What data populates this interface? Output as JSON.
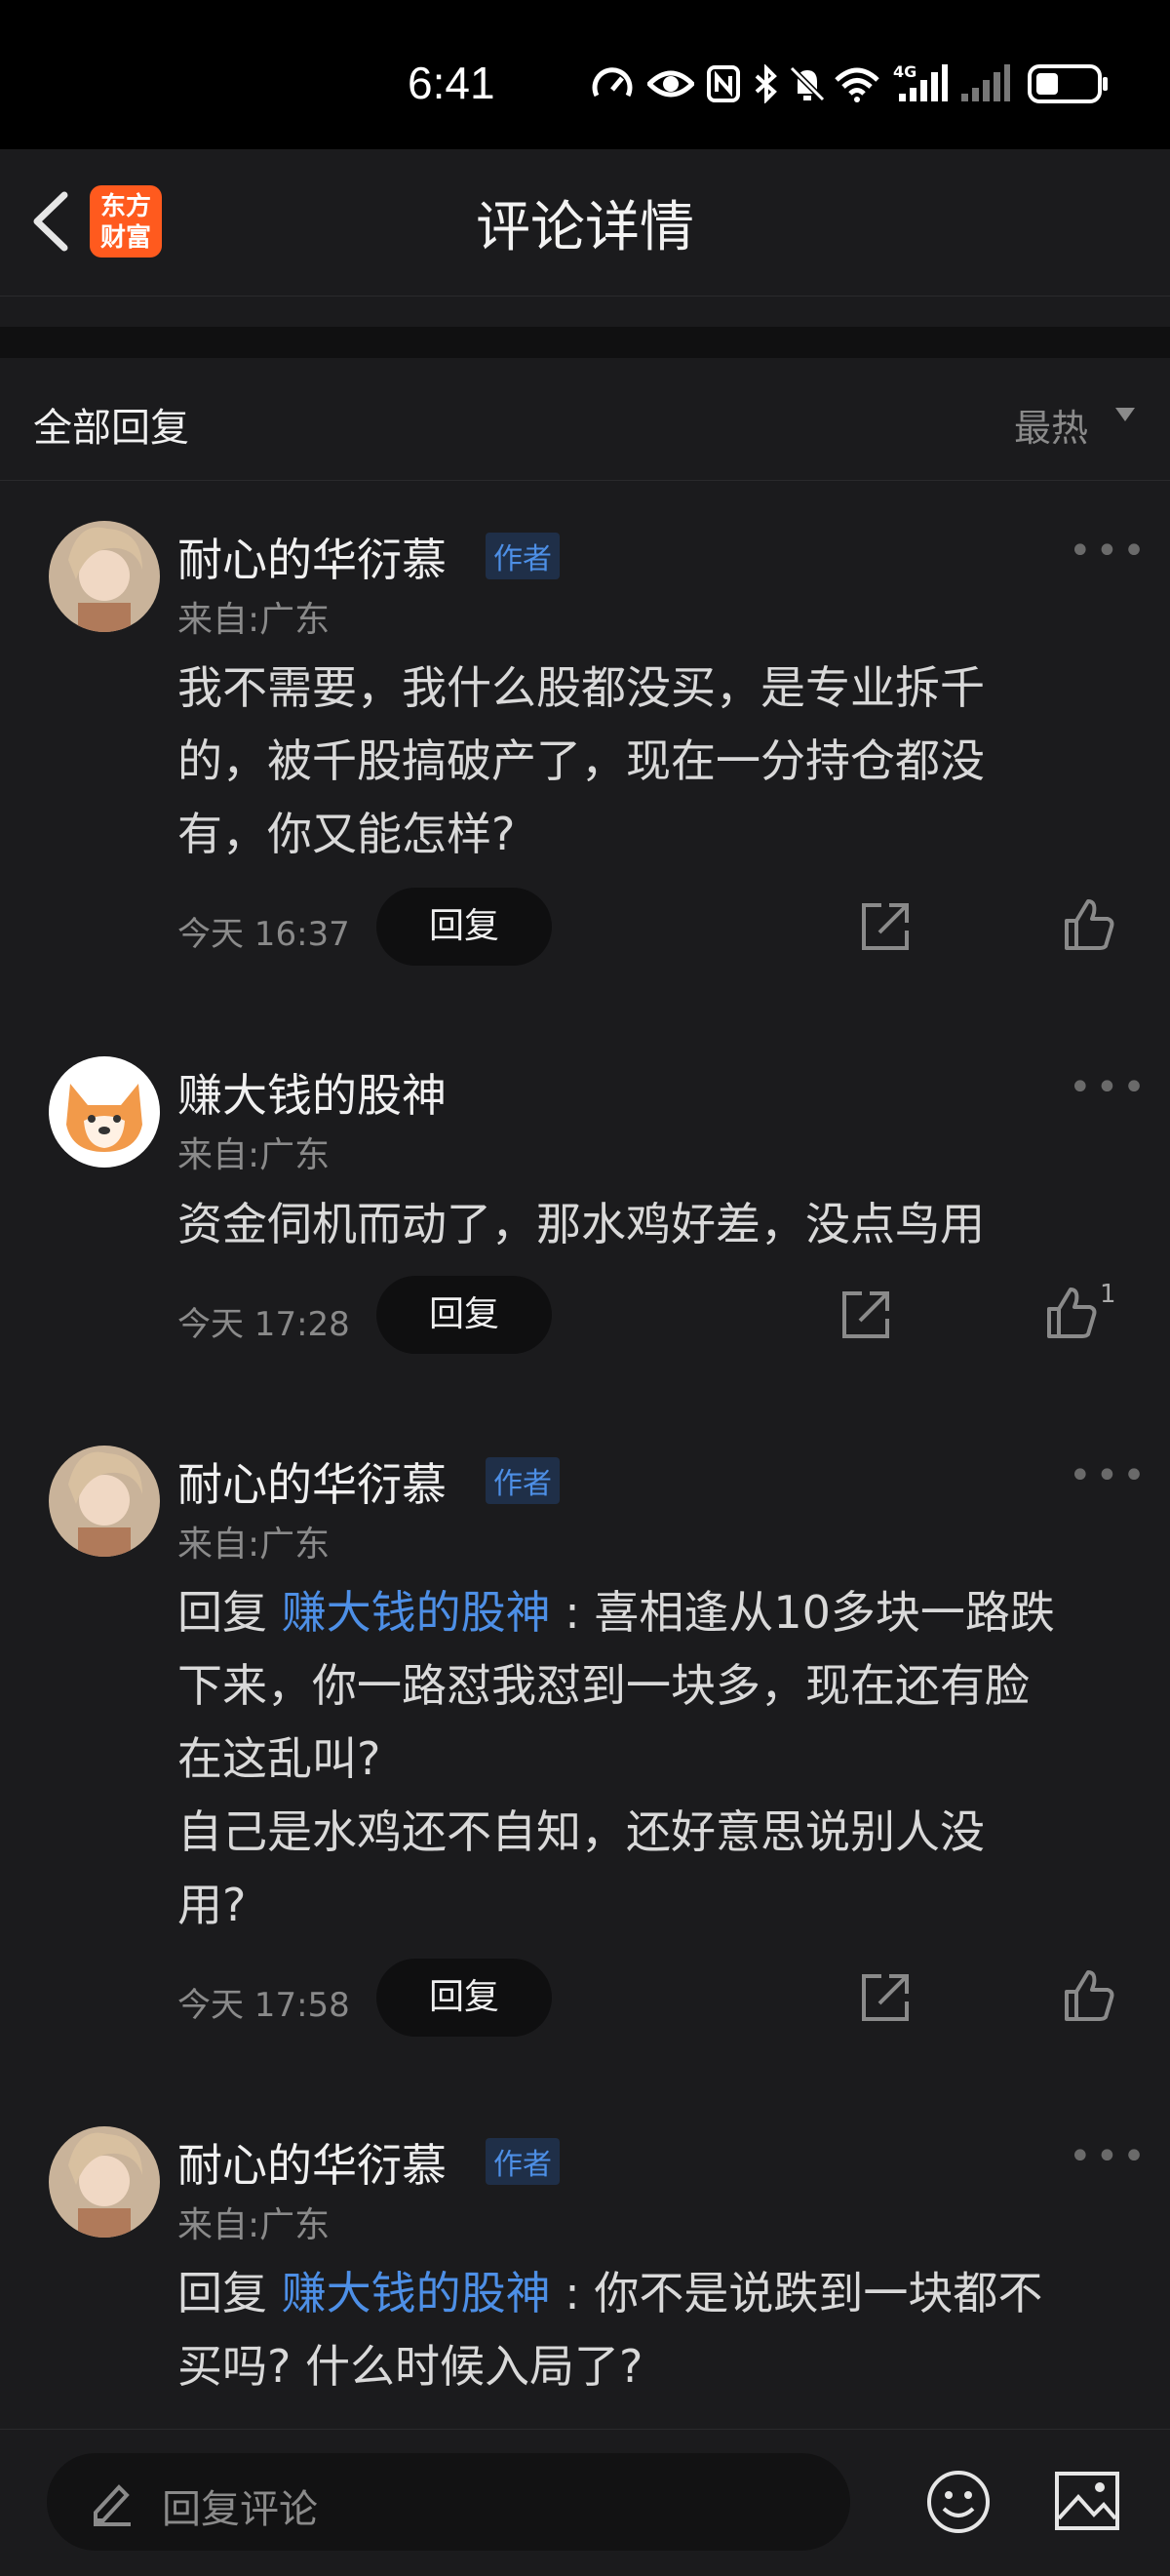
{
  "status": {
    "time": "6:41",
    "network": "4G"
  },
  "header": {
    "title": "评论详情",
    "logo_text_top": "东方",
    "logo_text_bottom": "财富"
  },
  "replies_header": {
    "label": "全部回复",
    "sort": "最热"
  },
  "comments": [
    {
      "user": "耐心的华衍慕",
      "badge": "作者",
      "location": "来自:广东",
      "lines": [
        "我不需要，我什么股都没买，是专业拆千",
        "的，被千股搞破产了，现在一分持仓都没",
        "有，你又能怎样?"
      ],
      "time": "今天 16:37",
      "reply_label": "回复",
      "likes": ""
    },
    {
      "user": "赚大钱的股神",
      "badge": "",
      "location": "来自:广东",
      "lines": [
        "资金伺机而动了，那水鸡好差，没点鸟用"
      ],
      "time": "今天 17:28",
      "reply_label": "回复",
      "likes": "1"
    },
    {
      "user": "耐心的华衍慕",
      "badge": "作者",
      "location": "来自:广东",
      "reply_prefix": "回复 ",
      "mention": "赚大钱的股神",
      "lines": [
        " : 喜相逢从10多块一路跌",
        "下来，你一路怼我怼到一块多，现在还有脸",
        "在这乱叫?",
        "自己是水鸡还不自知，还好意思说别人没",
        "用?"
      ],
      "time": "今天 17:58",
      "reply_label": "回复",
      "likes": ""
    },
    {
      "user": "耐心的华衍慕",
      "badge": "作者",
      "location": "来自:广东",
      "reply_prefix": "回复 ",
      "mention": "赚大钱的股神",
      "lines": [
        " : 你不是说跌到一块都不",
        "买吗? 什么时候入局了?"
      ]
    }
  ],
  "footer": {
    "placeholder": "回复评论"
  }
}
